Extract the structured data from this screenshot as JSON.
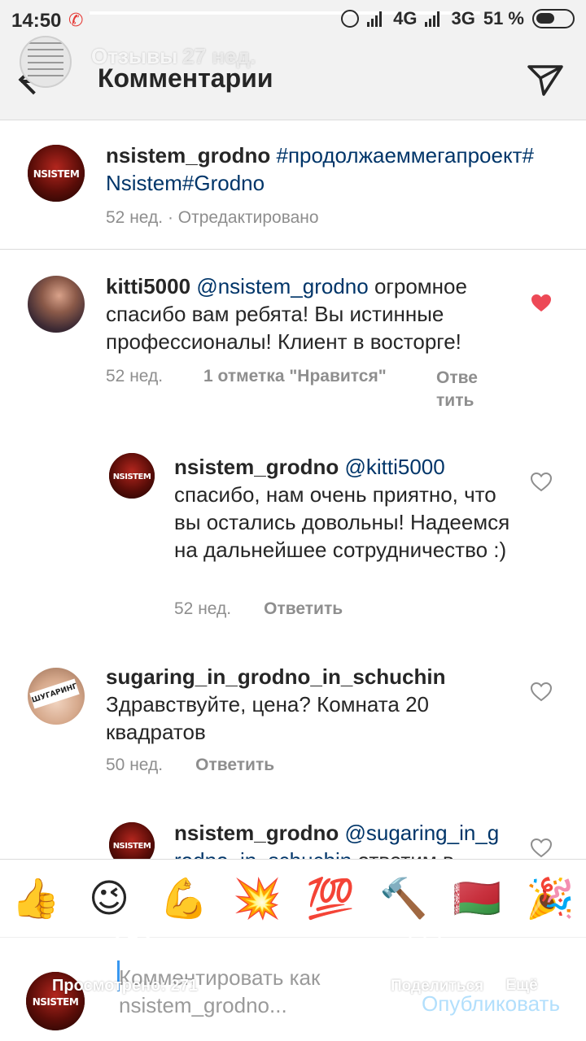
{
  "status_bar": {
    "time": "14:50",
    "network_1": "4G",
    "network_2": "3G",
    "battery": "51 %"
  },
  "story_overlay": {
    "title": "Отзывы",
    "time": "27 нед."
  },
  "header": {
    "title": "Комментарии"
  },
  "comments": [
    {
      "username": "nsistem_grodno",
      "text": "#продолжаеммегапроект#Nsistem#Grodno",
      "time": "52 нед.",
      "edited": "· Отредактировано"
    },
    {
      "username": "kitti5000",
      "mention": "@nsistem_grodno",
      "text": "огромное спасибо вам ребята! Вы истинные профессионалы! Клиент в восторге!",
      "time": "52 нед.",
      "likes": "1 отметка \"Нравится\"",
      "reply": "Ответить",
      "liked": true
    },
    {
      "username": "nsistem_grodno",
      "mention": "@kitti5000",
      "text": "спасибо, нам очень приятно, что вы остались довольны! Надеемся на дальнейшее сотрудничество :)",
      "time": "52 нед.",
      "reply": "Ответить"
    },
    {
      "username": "sugaring_in_grodno_in_schuchin",
      "text": "Здравствуйте, цена? Комната 20 квадратов",
      "time": "50 нед.",
      "reply": "Ответить"
    },
    {
      "username": "nsistem_grodno",
      "mention": "@sugaring_in_grodno_in_schuchin",
      "text": "ответим в"
    }
  ],
  "emoji_bar": [
    "👍",
    "😉",
    "💪",
    "💥",
    "💯",
    "🔨",
    "🇧🇾",
    "🎉"
  ],
  "composer": {
    "placeholder": "Комментировать как nsistem_grodno...",
    "publish": "Опубликовать"
  },
  "story_bottom": {
    "viewed": "Просмотрено: 271",
    "share": "Поделиться",
    "more": "Ещё"
  },
  "colors": {
    "like_red": "#ed4956",
    "link_blue": "#003569",
    "publish_blue": "#b2dffc"
  }
}
